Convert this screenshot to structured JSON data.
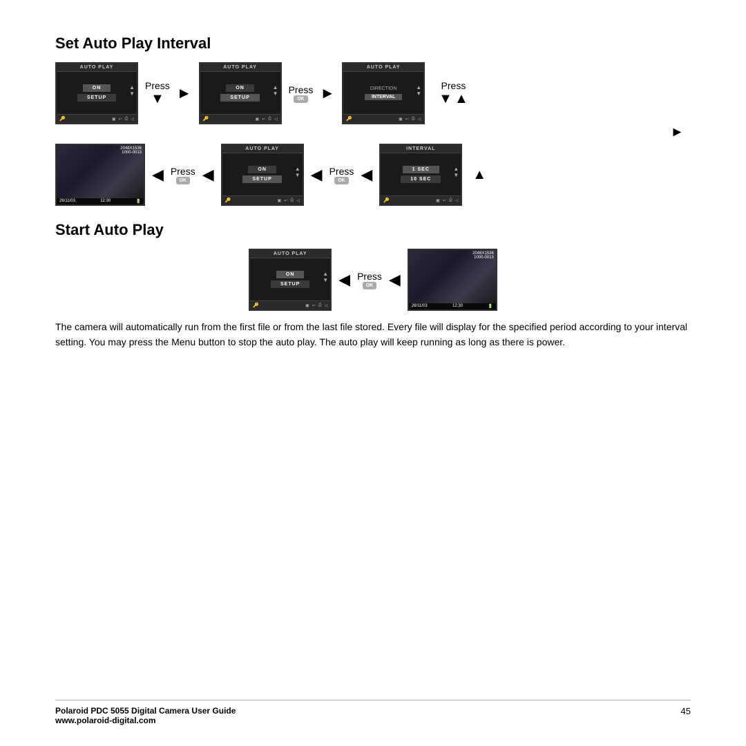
{
  "page": {
    "section1_title": "Set Auto Play Interval",
    "section2_title": "Start Auto Play",
    "press_labels": {
      "down": "Press",
      "ok1": "Press",
      "press_down2": "Press",
      "ok2": "Press",
      "ok3": "Press",
      "start_press": "Press"
    },
    "ok_button": "OK",
    "screens": {
      "auto_play_top": "AUTO PLAY",
      "auto_play_on": "ON",
      "auto_play_setup": "SETUP",
      "interval_top": "INTERVAL",
      "interval_1sec": "1 SEC",
      "interval_10sec": "10 SEC",
      "direction": "DIRECTION",
      "interval_label": "INTERVAL",
      "photo_info": "2048X1536",
      "photo_id": "1000-0013",
      "photo_date": "26/11/03",
      "photo_time": "12:30"
    },
    "description": "The camera will automatically run from the first file or from the last file stored. Every file will display for the specified period according to your interval setting. You may press the Menu button to stop the auto play. The auto play will keep running as long as there is power.",
    "footer": {
      "left_bold": "Polaroid PDC 5055 Digital Camera User Guide",
      "left_url": "www.polaroid-digital.com",
      "page_number": "45"
    }
  }
}
